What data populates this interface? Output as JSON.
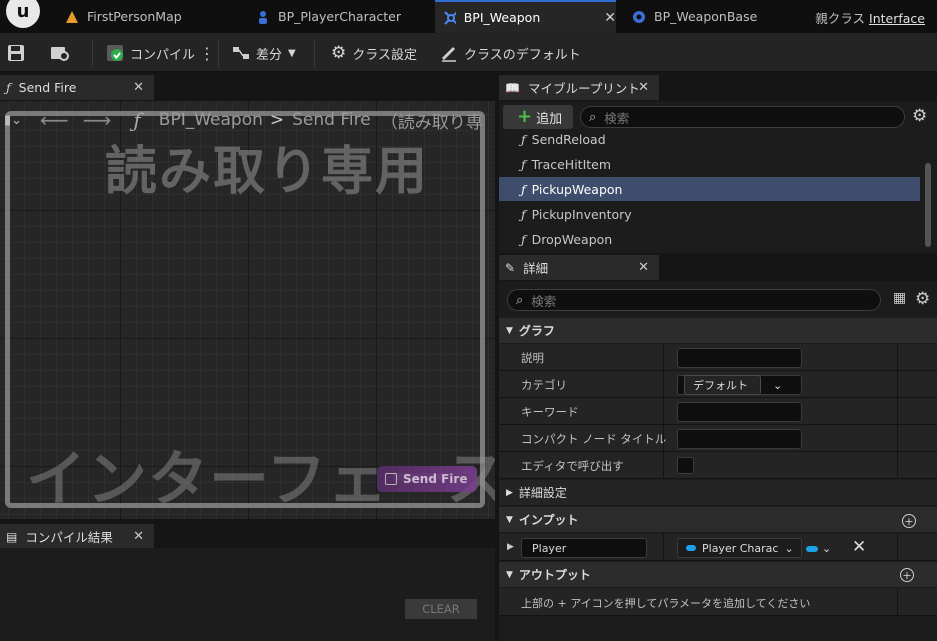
{
  "tabs": [
    {
      "label": "FirstPersonMap",
      "icon": "level-icon"
    },
    {
      "label": "BP_PlayerCharacter",
      "icon": "character-icon"
    },
    {
      "label": "BPI_Weapon",
      "icon": "interface-icon",
      "active": true
    },
    {
      "label": "BP_WeaponBase",
      "icon": "blueprint-icon"
    }
  ],
  "parent_class": {
    "label": "親クラス",
    "value": "Interface"
  },
  "toolbar": {
    "compile": "コンパイル",
    "diff": "差分",
    "class_settings": "クラス設定",
    "class_defaults": "クラスのデフォルト"
  },
  "graph_tab": {
    "label": "Send Fire"
  },
  "graph": {
    "breadcrumb_root": "BPI_Weapon",
    "breadcrumb_sep": ">",
    "breadcrumb_current": "Send Fire",
    "breadcrumb_suffix": "（読み取り専",
    "watermark_readonly": "読み取り専用",
    "watermark_type": "インターフェース",
    "node_label": "Send Fire"
  },
  "compile_results": {
    "tab": "コンパイル結果",
    "clear": "CLEAR"
  },
  "my_blueprint": {
    "tab": "マイブループリント",
    "add": "追加",
    "search_placeholder": "検索",
    "items": [
      "SendReload",
      "TraceHitItem",
      "PickupWeapon",
      "PickupInventory",
      "DropWeapon"
    ],
    "selected": "PickupWeapon"
  },
  "details": {
    "tab": "詳細",
    "search_placeholder": "検索",
    "graph_section": "グラフ",
    "rows": {
      "description": "説明",
      "category": "カテゴリ",
      "category_value": "デフォルト",
      "keywords": "キーワード",
      "compact_title": "コンパクト ノード タイトル",
      "call_in_editor": "エディタで呼び出す"
    },
    "advanced": "詳細設定",
    "inputs_section": "インプット",
    "input_name": "Player",
    "input_type": "Player Charac",
    "outputs_section": "アウトプット",
    "outputs_hint": "上部の + アイコンを押してパラメータを追加してください"
  },
  "colors": {
    "accent": "#2f6fd6",
    "selection": "#3d4d6b",
    "pin": "#1aa3e8",
    "node": "#7d3f91"
  }
}
